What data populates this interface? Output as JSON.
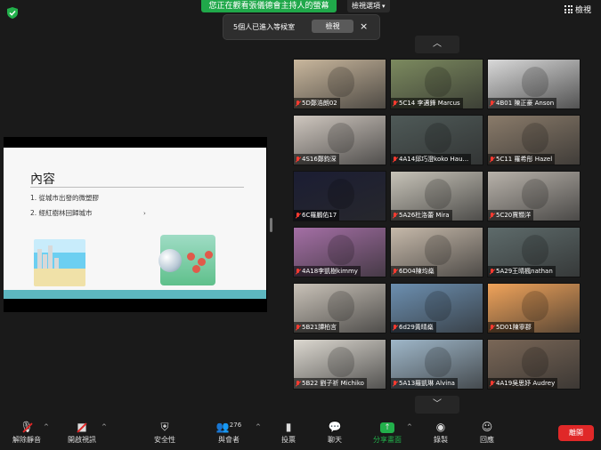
{
  "top": {
    "share_banner": "您正在觀看張儀德會主持人的螢幕",
    "view_options": "檢視選項",
    "view_label": "檢視"
  },
  "waiting_room": {
    "message": "5個人已進入等候室",
    "view_button": "檢視",
    "close": "×"
  },
  "slide": {
    "title": "內容",
    "items": [
      "1. 從城市出發的微塑膠",
      "2. 經紅樹林回歸城市"
    ],
    "mark": "›"
  },
  "gallery": {
    "up": "︿",
    "down": "﹀",
    "tiles": [
      {
        "label": "5D鄭浩朗02",
        "bg": "#c9b79d"
      },
      {
        "label": "5C14 李邁鋒 Marcus",
        "bg": "#7c8a5f"
      },
      {
        "label": "4B01 陳正豪 Anson",
        "bg": "#d9d9d9"
      },
      {
        "label": "4S16鄭鈞深",
        "bg": "#cfc7bf"
      },
      {
        "label": "4A14邱巧澄koko Hau...",
        "bg": "#4f5a58"
      },
      {
        "label": "5C11 羅希彤 Hazel",
        "bg": "#8a7b6a"
      },
      {
        "label": "6C羅鵬佑17",
        "bg": "#1b1d33"
      },
      {
        "label": "5A26杜洛蕾 Mira",
        "bg": "#c7c3b8"
      },
      {
        "label": "5C20賈顥洋",
        "bg": "#b8b2aa"
      },
      {
        "label": "4A18李凱樹kimmy",
        "bg": "#a46fa5"
      },
      {
        "label": "6D04陳均燊",
        "bg": "#c6b9aa"
      },
      {
        "label": "5A29王晴楓nathan",
        "bg": "#5e6b6b"
      },
      {
        "label": "5B21譚柏言",
        "bg": "#c9c2b8"
      },
      {
        "label": "6d29黃晴燊",
        "bg": "#6c8fb0"
      },
      {
        "label": "5D01陳寧郡",
        "bg": "#f0a35a"
      },
      {
        "label": "5B22 劉子祈 Michiko",
        "bg": "#dcd8d0"
      },
      {
        "label": "5A13羅凱琳 Alvina",
        "bg": "#9fb7c9"
      },
      {
        "label": "4A19吳思妤 Audrey",
        "bg": "#7a6757"
      }
    ]
  },
  "toolbar": {
    "unmute": "解除靜音",
    "start_video": "開啟視訊",
    "security": "安全性",
    "participants": "與會者",
    "participant_count": "276",
    "polls": "投票",
    "chat": "聊天",
    "share_screen": "分享畫面",
    "record": "錄製",
    "reactions": "回應",
    "end": "離開",
    "accent": "#22b04b",
    "end_color": "#e02828"
  }
}
